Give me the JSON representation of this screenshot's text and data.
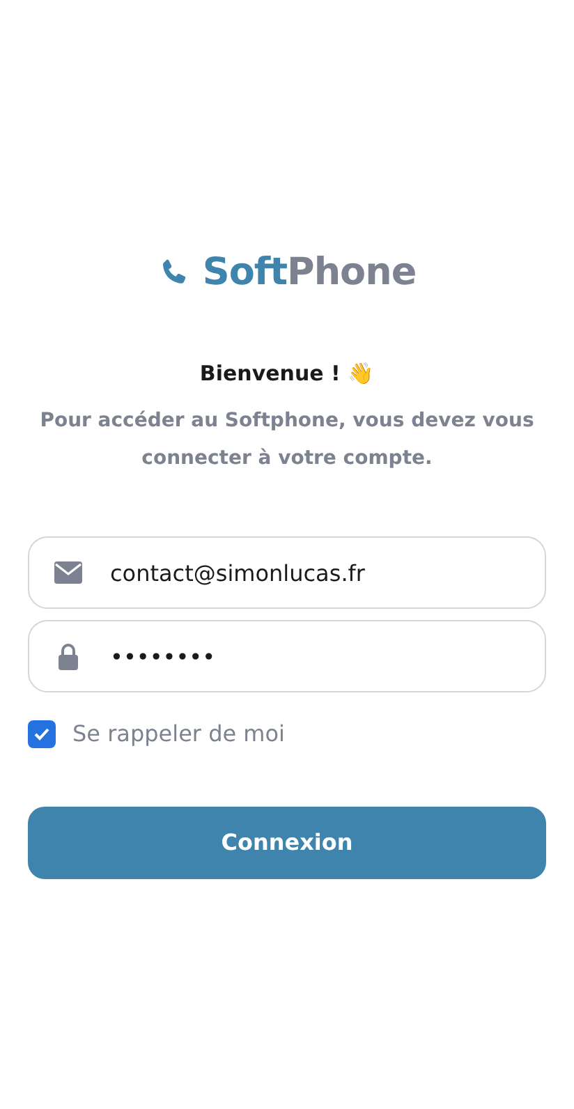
{
  "logo": {
    "first": "Soft",
    "second": "Phone"
  },
  "welcome": "Bienvenue ! 👋",
  "description": "Pour accéder au Softphone, vous devez vous connecter à votre compte.",
  "email": {
    "value": "contact@simonlucas.fr"
  },
  "password": {
    "value": "••••••••"
  },
  "remember": {
    "label": "Se rappeler de moi",
    "checked": true
  },
  "submit": "Connexion"
}
